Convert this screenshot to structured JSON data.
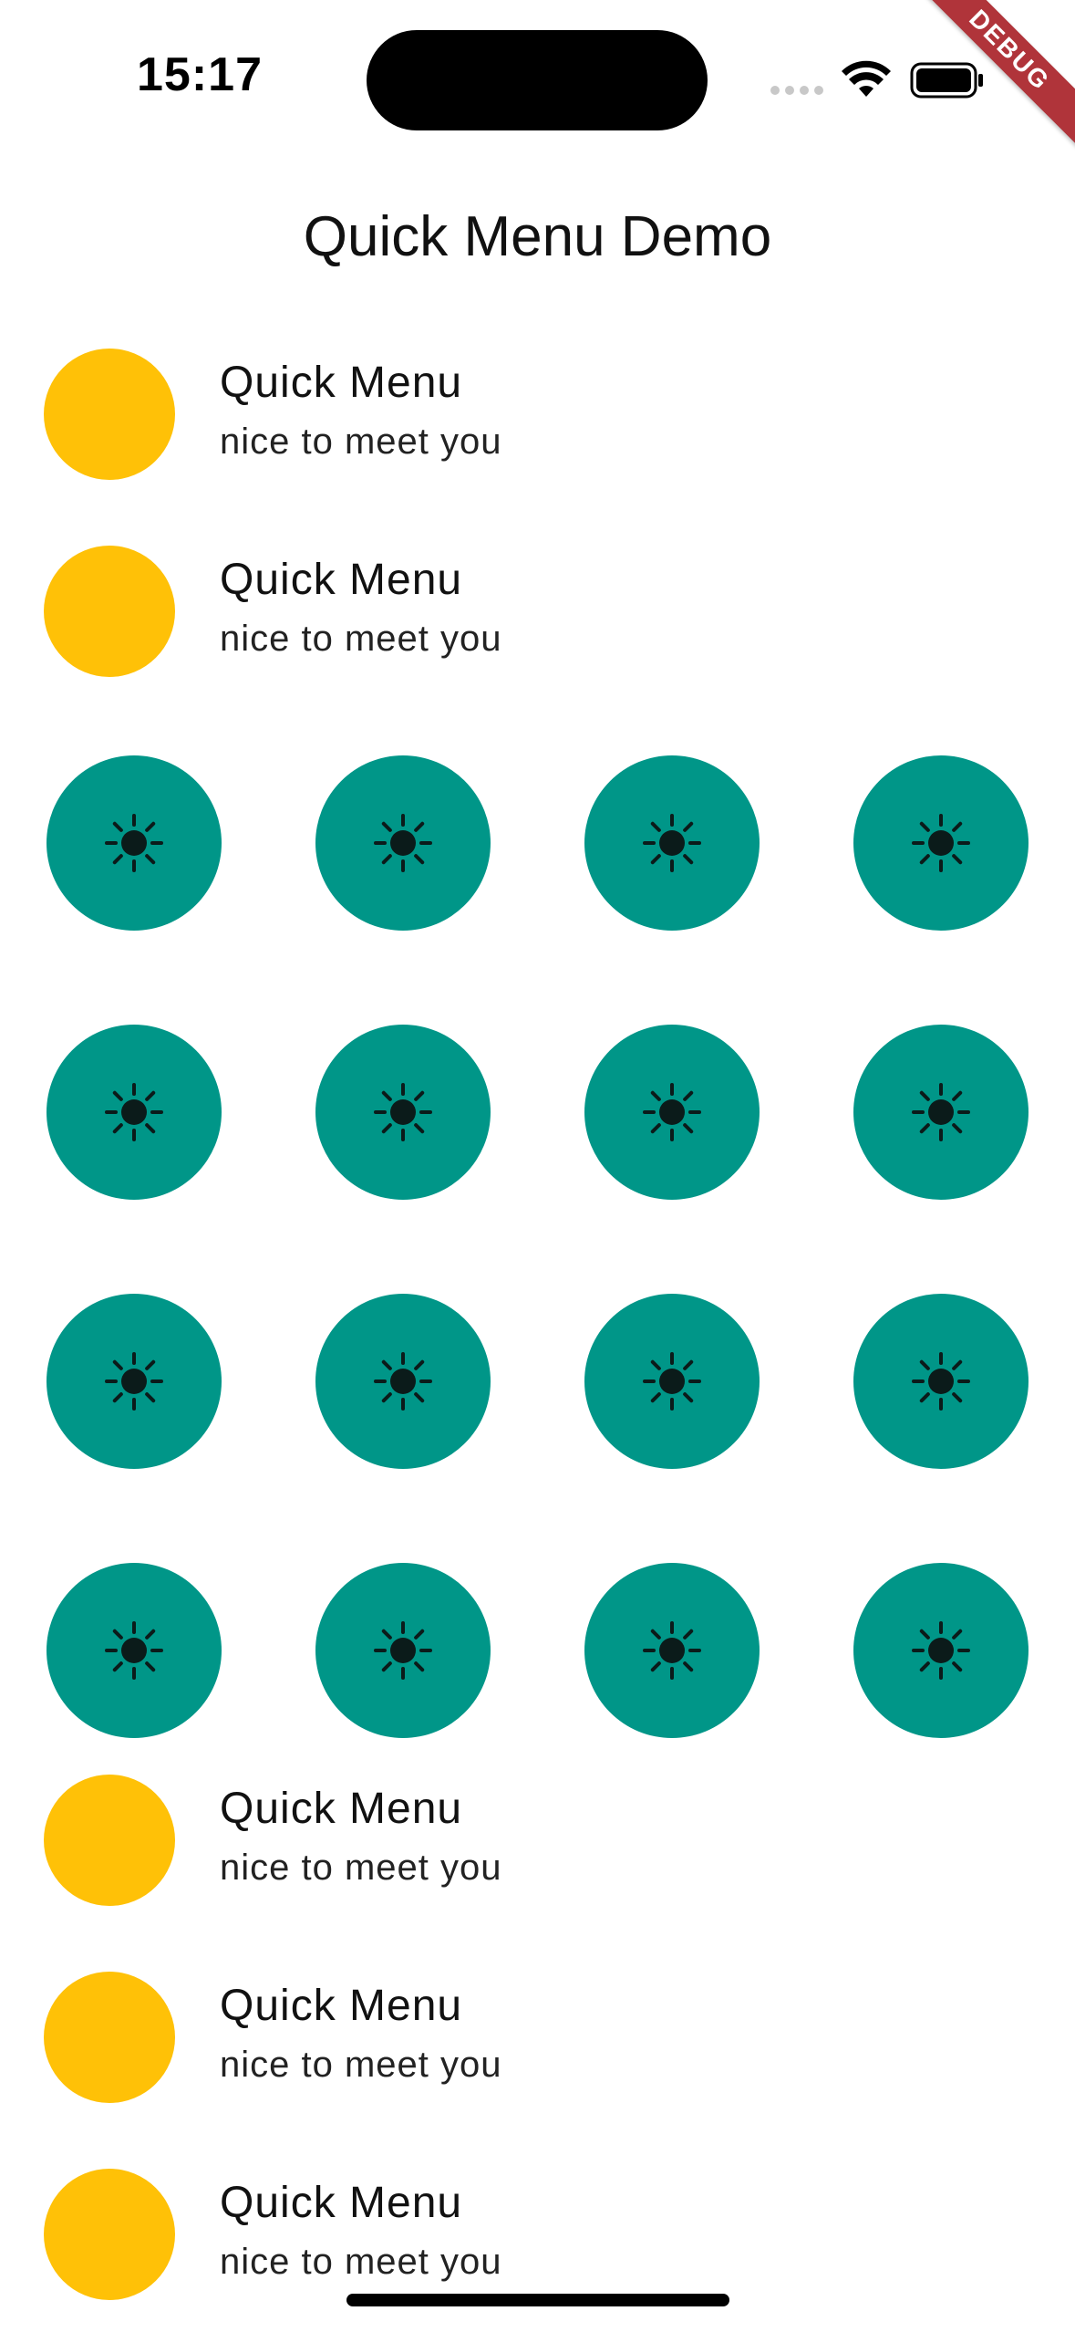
{
  "status_bar": {
    "time": "15:17",
    "debug_label": "DEBUG"
  },
  "app_bar": {
    "title": "Quick Menu Demo"
  },
  "list_items_top": [
    {
      "title": "Quick Menu",
      "subtitle": "nice to meet you"
    },
    {
      "title": "Quick Menu",
      "subtitle": "nice to meet you"
    }
  ],
  "grid": {
    "rows": 4,
    "columns": 4,
    "icon": "sun-icon",
    "button_color": "#009688",
    "icon_color": "#0b1b1a"
  },
  "list_items_bottom": [
    {
      "title": "Quick Menu",
      "subtitle": "nice to meet you"
    },
    {
      "title": "Quick Menu",
      "subtitle": "nice to meet you"
    },
    {
      "title": "Quick Menu",
      "subtitle": "nice to meet you"
    }
  ],
  "colors": {
    "avatar": "#ffc107",
    "teal": "#009688",
    "debug_ribbon": "#b0343a"
  }
}
